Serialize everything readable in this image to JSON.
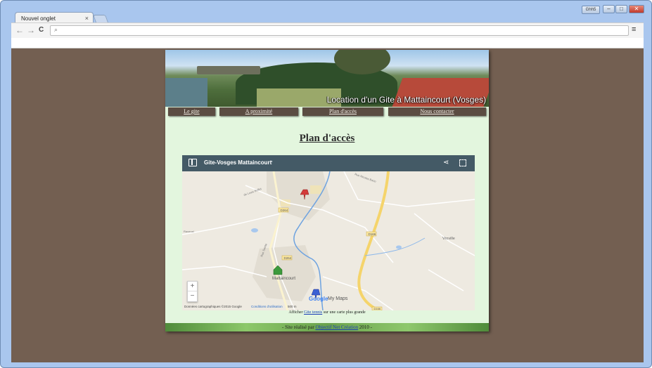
{
  "browser": {
    "tab_title": "Nouvel onglet",
    "tab_close": "×",
    "title_badge": "Ghh5",
    "controls": {
      "minimize": "–",
      "maximize": "□",
      "close": "✕"
    },
    "nav": {
      "back": "←",
      "forward": "→",
      "reload": "C"
    },
    "omnibox_value": "",
    "menu_glyph": "≡"
  },
  "site": {
    "banner_title": "Location d'un Gite à Mattaincourt (Vosges)",
    "nav_items": [
      "Le gite",
      "A proximité",
      "Plan d'accès",
      "Nous contacter"
    ],
    "page_title": "Plan d'accès",
    "map": {
      "title": "Gite-Vosges Mattaincourt",
      "info_glyph": "▪",
      "zoom_in": "+",
      "zoom_out": "−",
      "attribution": "Données cartographiques ©2015 Google",
      "terms": "Conditions d'utilisation",
      "scale": "500 m",
      "logo": "Google",
      "mymaps": "My Maps",
      "labels": {
        "road1": "D264",
        "road2": "D166",
        "road3": "D264",
        "place1": "Mattaincourt",
        "place2": "Vroville",
        "street1": "de Louis Buffet",
        "street2": "Ravenel",
        "street3": "Rue Nicolas Barin",
        "street4": "Rue Sainte",
        "road5": "D166"
      },
      "colors": {
        "water": "#a8c8ee",
        "river": "#6ea3e0",
        "highway": "#f5d46b",
        "road": "#ffffff"
      }
    },
    "map_caption": {
      "before": "Afficher",
      "link": "Gite tennis",
      "after": "sur une carte plus grande"
    },
    "footer": {
      "before": "- Site réalisé par",
      "link": "Objectif Net Création",
      "after": "2010 -"
    }
  }
}
